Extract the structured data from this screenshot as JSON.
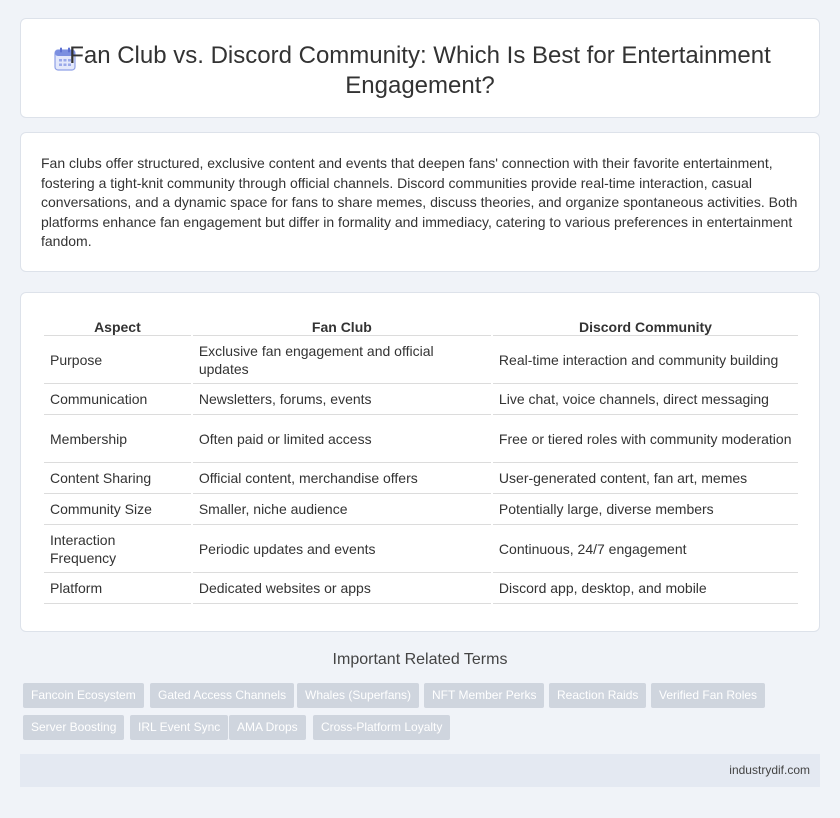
{
  "header": {
    "title_line1": "Fan Club vs. Discord Community: Which Is Best for Entertainment",
    "title_line2": "Engagement?",
    "icon": "calendar-icon"
  },
  "intro": {
    "text": "Fan clubs offer structured, exclusive content and events that deepen fans' connection with their favorite entertainment, fostering a tight-knit community through official channels. Discord communities provide real-time interaction, casual conversations, and a dynamic space for fans to share memes, discuss theories, and organize spontaneous activities. Both platforms enhance fan engagement but differ in formality and immediacy, catering to various preferences in entertainment fandom."
  },
  "table": {
    "headers": [
      "Aspect",
      "Fan Club",
      "Discord Community"
    ],
    "rows": [
      [
        "Purpose",
        "Exclusive fan engagement and official updates",
        "Real-time interaction and community building"
      ],
      [
        "Communication",
        "Newsletters, forums, events",
        "Live chat, voice channels, direct messaging"
      ],
      [
        "Membership",
        "Often paid or limited access",
        "Free or tiered roles with community moderation"
      ],
      [
        "Content Sharing",
        "Official content, merchandise offers",
        "User-generated content, fan art, memes"
      ],
      [
        "Community Size",
        "Smaller, niche audience",
        "Potentially large, diverse members"
      ],
      [
        "Interaction Frequency",
        "Periodic updates and events",
        "Continuous, 24/7 engagement"
      ],
      [
        "Platform",
        "Dedicated websites or apps",
        "Discord app, desktop, and mobile"
      ]
    ]
  },
  "related": {
    "title": "Important Related Terms",
    "tags": [
      "Fancoin Ecosystem",
      "Gated Access Channels",
      "Whales (Superfans)",
      "NFT Member Perks",
      "Reaction Raids",
      "Verified Fan Roles",
      "Server Boosting",
      "IRL Event Sync",
      "AMA Drops",
      "Cross-Platform Loyalty"
    ]
  },
  "footer": {
    "text": "industrydif.com"
  },
  "colors": {
    "background": "#f0f3f8",
    "tag": "#cfd5de",
    "footer": "#e4e9f2",
    "icon": "#7b8fe0"
  }
}
